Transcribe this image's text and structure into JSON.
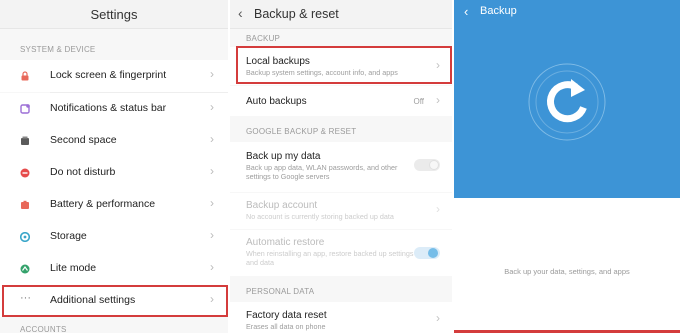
{
  "settings": {
    "title": "Settings",
    "section1": "SYSTEM & DEVICE",
    "items": [
      {
        "label": "Lock screen & fingerprint",
        "icon": "lock-icon",
        "color": "#e8685a"
      },
      {
        "label": "Notifications & status bar",
        "icon": "notification-icon",
        "color": "#9c6fd6"
      },
      {
        "label": "Second space",
        "icon": "second-space-icon",
        "color": "#5a5a5a"
      },
      {
        "label": "Do not disturb",
        "icon": "moon-icon",
        "color": "#e64b4b"
      },
      {
        "label": "Battery & performance",
        "icon": "battery-icon",
        "color": "#e8685a"
      },
      {
        "label": "Storage",
        "icon": "storage-icon",
        "color": "#3aa6c9"
      },
      {
        "label": "Lite mode",
        "icon": "lite-mode-icon",
        "color": "#34a26b"
      },
      {
        "label": "Additional settings",
        "icon": "more-dots-icon",
        "color": "#777777"
      }
    ],
    "section2": "ACCOUNTS"
  },
  "backup_reset": {
    "title": "Backup & reset",
    "section_backup": "BACKUP",
    "local_backups": {
      "title": "Local backups",
      "subtitle": "Backup system settings, account info, and apps"
    },
    "auto_backups": {
      "title": "Auto backups",
      "value": "Off"
    },
    "section_google": "GOOGLE BACKUP & RESET",
    "back_up_data": {
      "title": "Back up my data",
      "subtitle": "Back up app data, WLAN passwords, and other settings to Google servers",
      "enabled": false
    },
    "backup_account": {
      "title": "Backup account",
      "subtitle": "No account is currently storing backed up data"
    },
    "automatic_restore": {
      "title": "Automatic restore",
      "subtitle": "When reinstalling an app, restore backed up settings and data",
      "enabled": true
    },
    "section_personal": "PERSONAL DATA",
    "factory_reset": {
      "title": "Factory data reset",
      "subtitle": "Erases all data on phone"
    }
  },
  "backup": {
    "title": "Backup",
    "description": "Back up your data, settings, and apps"
  },
  "colors": {
    "accent_blue": "#3d94d6",
    "highlight_red": "#d43c3c",
    "toggle_on": "#76bde8"
  }
}
